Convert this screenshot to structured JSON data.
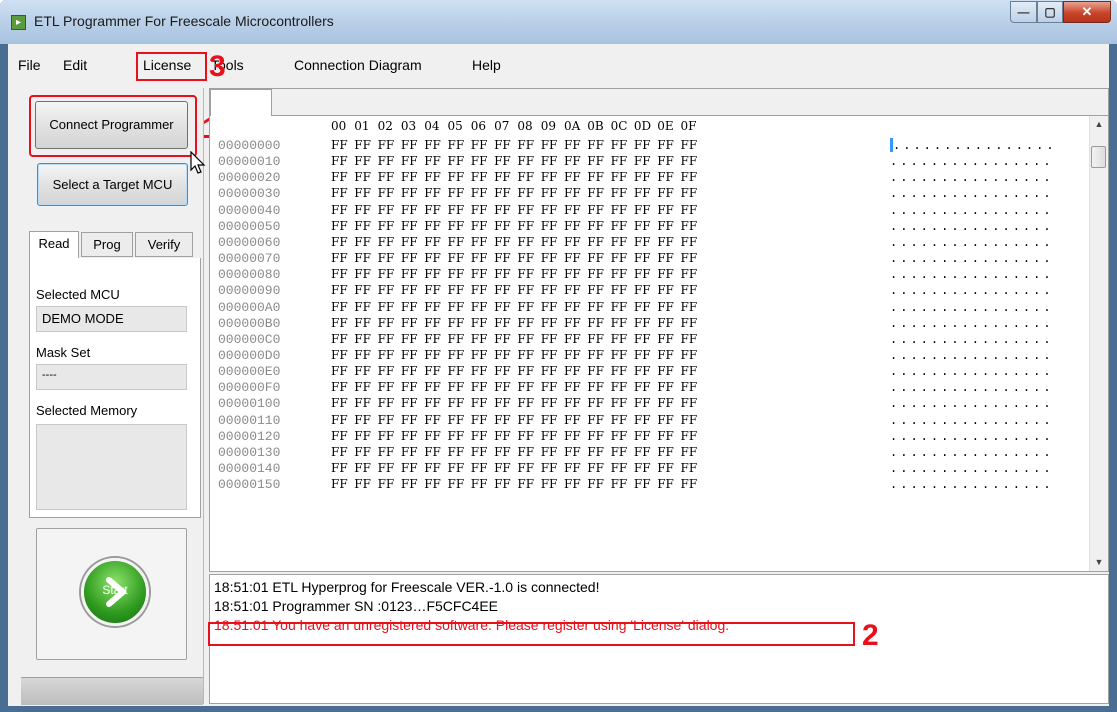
{
  "window": {
    "title": "ETL Programmer For Freescale Microcontrollers"
  },
  "window_controls": {
    "minimize": "—",
    "maximize": "▢",
    "close": "✕"
  },
  "menu": {
    "items": [
      "File",
      "Edit",
      "License",
      "Tools",
      "Connection Diagram",
      "Help"
    ]
  },
  "annotations": {
    "a1": "1",
    "a2": "2",
    "a3": "3"
  },
  "left": {
    "connect_label": "Connect Programmer",
    "select_label": "Select a Target MCU",
    "tabs": [
      "Read",
      "Prog",
      "Verify"
    ],
    "selected_mcu_label": "Selected MCU",
    "selected_mcu_value": "DEMO MODE",
    "mask_set_label": "Mask Set",
    "mask_set_value": "----",
    "selected_memory_label": "Selected Memory",
    "selected_memory_value": "",
    "start_label": "Start"
  },
  "hex": {
    "columns": [
      "00",
      "01",
      "02",
      "03",
      "04",
      "05",
      "06",
      "07",
      "08",
      "09",
      "0A",
      "0B",
      "0C",
      "0D",
      "0E",
      "0F"
    ],
    "cell_value": "FF",
    "addresses": [
      "00000000",
      "00000010",
      "00000020",
      "00000030",
      "00000040",
      "00000050",
      "00000060",
      "00000070",
      "00000080",
      "00000090",
      "000000A0",
      "000000B0",
      "000000C0",
      "000000D0",
      "000000E0",
      "000000F0",
      "00000100",
      "00000110",
      "00000120",
      "00000130",
      "00000140",
      "00000150"
    ],
    "ascii": "................"
  },
  "log": {
    "lines": [
      {
        "text": "18:51:01  ETL Hyperprog for Freescale VER.-1.0 is connected!",
        "color": "#000000"
      },
      {
        "text": "18:51:01  Programmer SN :0123…F5CFC4EE",
        "color": "#000000"
      },
      {
        "text": "18:51:01  You have an unregistered software. Please register using 'License' dialog.",
        "color": "#e8101c"
      }
    ]
  },
  "colors": {
    "annotation": "#e8101c",
    "accent": "#2d9a1e"
  }
}
